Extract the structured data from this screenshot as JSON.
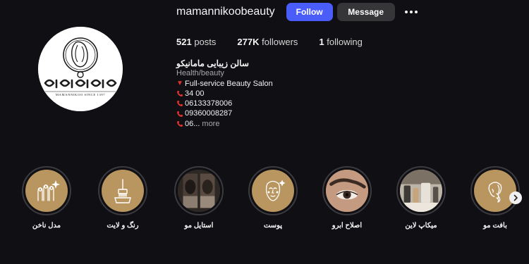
{
  "profile": {
    "username": "mamannikoobeauty",
    "follow_label": "Follow",
    "message_label": "Message",
    "logo_text": "ماماننیکو",
    "logo_subtext": "MAMANNIKOO SINCE 1397"
  },
  "stats": {
    "posts_count": "521",
    "posts_label": "posts",
    "followers_count": "277K",
    "followers_label": "followers",
    "following_count": "1",
    "following_label": "following"
  },
  "bio": {
    "name": "سالن زیبایی مامانیکو",
    "category": "Health/beauty",
    "lines": [
      {
        "icon": "red-triangle-icon",
        "text": "Full-service Beauty Salon"
      },
      {
        "icon": "phone-icon",
        "text": "34 00"
      },
      {
        "icon": "phone-icon",
        "text": "06133378006"
      },
      {
        "icon": "phone-icon",
        "text": "09360008287"
      },
      {
        "icon": "phone-icon",
        "text": "06..."
      }
    ],
    "more_label": "more"
  },
  "highlights": [
    {
      "label": "مدل ناخن",
      "icon": "nail-hands-icon"
    },
    {
      "label": "رنگ و لایت",
      "icon": "hair-dye-brush-icon"
    },
    {
      "label": "استایل مو",
      "icon": "hair-style-photo"
    },
    {
      "label": "پوست",
      "icon": "face-skin-icon"
    },
    {
      "label": "اصلاح ابرو",
      "icon": "eyebrow-photo"
    },
    {
      "label": "میکاپ لاین",
      "icon": "makeup-line-photo"
    },
    {
      "label": "بافت مو",
      "icon": "braid-hair-icon"
    }
  ],
  "colors": {
    "background": "#0f0f14",
    "follow_button": "#4a5df9",
    "message_button": "#363638",
    "highlight_gold": "#b99560"
  }
}
